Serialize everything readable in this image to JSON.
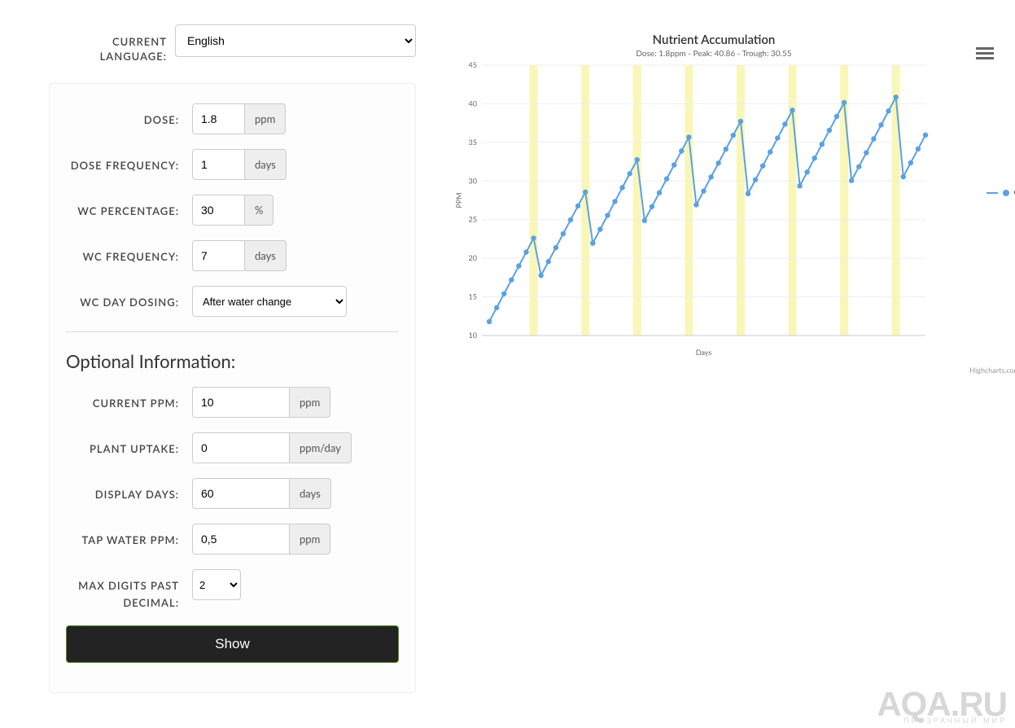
{
  "language": {
    "label": "CURRENT LANGUAGE:",
    "value": "English"
  },
  "form": {
    "dose": {
      "label": "DOSE:",
      "value": "1.8",
      "unit": "ppm"
    },
    "dose_freq": {
      "label": "DOSE FREQUENCY:",
      "value": "1",
      "unit": "days"
    },
    "wc_pct": {
      "label": "WC PERCENTAGE:",
      "value": "30",
      "unit": "%"
    },
    "wc_freq": {
      "label": "WC FREQUENCY:",
      "value": "7",
      "unit": "days"
    },
    "wc_day_dosing": {
      "label": "WC DAY DOSING:",
      "value": "After water change"
    }
  },
  "optional_title": "Optional Information:",
  "optional": {
    "current_ppm": {
      "label": "CURRENT PPM:",
      "value": "10",
      "unit": "ppm"
    },
    "plant_uptake": {
      "label": "PLANT UPTAKE:",
      "value": "0",
      "unit": "ppm/day"
    },
    "display_days": {
      "label": "DISPLAY DAYS:",
      "value": "60",
      "unit": "days"
    },
    "tap_water": {
      "label": "TAP WATER PPM:",
      "value": "0,5",
      "unit": "ppm"
    },
    "max_digits": {
      "label": "MAX DIGITS PAST DECIMAL:",
      "value": "2"
    }
  },
  "show_button": "Show",
  "chart": {
    "title": "Nutrient Accumulation",
    "subtitle": "Dose: 1.8ppm - Peak: 40.86 - Trough: 30.55",
    "xlabel": "Days",
    "ylabel": "PPM",
    "credit": "Highcharts.com",
    "legend_label": "C",
    "y_ticks": [
      10,
      15,
      20,
      25,
      30,
      35,
      40,
      45
    ]
  },
  "chart_data": {
    "type": "line",
    "title": "Nutrient Accumulation",
    "xlabel": "Days",
    "ylabel": "PPM",
    "ylim": [
      10,
      45
    ],
    "xlim": [
      0,
      60
    ],
    "series": [
      {
        "name": "C",
        "x": [
          1,
          2,
          3,
          4,
          5,
          6,
          7,
          8,
          9,
          10,
          11,
          12,
          13,
          14,
          15,
          16,
          17,
          18,
          19,
          20,
          21,
          22,
          23,
          24,
          25,
          26,
          27,
          28,
          29,
          30,
          31,
          32,
          33,
          34,
          35,
          36,
          37,
          38,
          39,
          40,
          41,
          42,
          43,
          44,
          45,
          46,
          47,
          48,
          49,
          50,
          51,
          52,
          53,
          54,
          55,
          56,
          57,
          58,
          59,
          60
        ],
        "values": [
          11.8,
          13.6,
          15.4,
          17.2,
          19.0,
          20.8,
          22.6,
          17.77,
          19.57,
          21.37,
          23.17,
          24.97,
          26.77,
          28.57,
          21.95,
          23.75,
          25.55,
          27.35,
          29.15,
          30.95,
          32.75,
          24.88,
          26.68,
          28.48,
          30.28,
          32.08,
          33.88,
          35.68,
          26.92,
          28.72,
          30.52,
          32.32,
          34.12,
          35.92,
          37.72,
          28.36,
          30.16,
          31.96,
          33.76,
          35.56,
          37.36,
          39.16,
          29.36,
          31.16,
          32.96,
          34.76,
          36.56,
          38.36,
          40.16,
          30.06,
          31.86,
          33.66,
          35.46,
          37.26,
          39.06,
          40.86,
          30.55,
          32.35,
          34.15,
          35.95
        ]
      }
    ],
    "wc_days": [
      7,
      14,
      21,
      28,
      35,
      42,
      49,
      56
    ]
  },
  "watermark": {
    "big": "AQA.RU",
    "small": "ПРОЗРАЧНЫЙ МИР"
  }
}
